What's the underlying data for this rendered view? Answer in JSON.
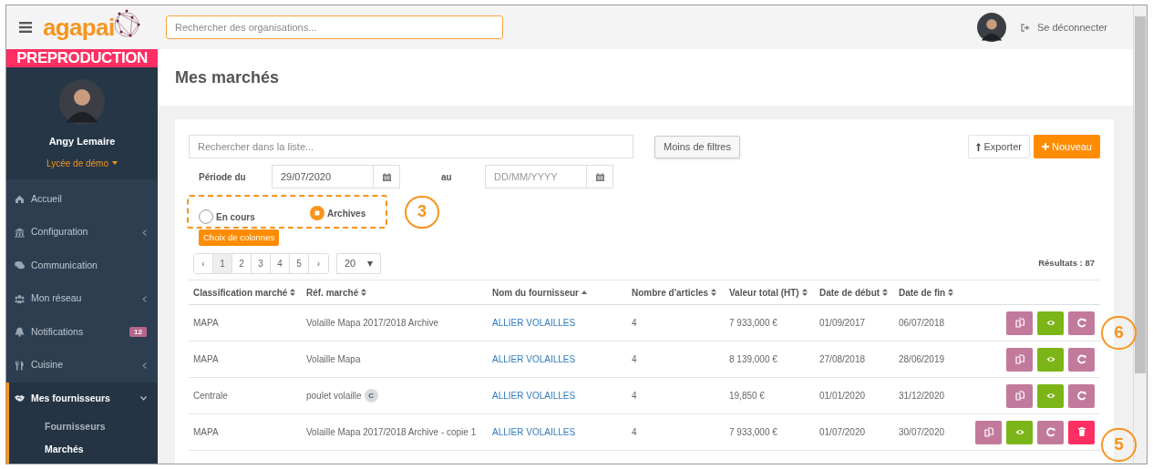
{
  "topbar": {
    "logo": "agapai",
    "search": {
      "placeholder": "Rechercher des organisations..."
    },
    "logout": "Se déconnecter"
  },
  "sidebar": {
    "banner": "PREPRODUCTION",
    "user": {
      "name": "Angy Lemaire",
      "organisation": "Lycée de démo"
    },
    "items": [
      {
        "label": "Accueil",
        "selected": false
      },
      {
        "label": "Configuration",
        "selected": false,
        "expanded": false
      },
      {
        "label": "Communication",
        "selected": false
      },
      {
        "label": "Mon réseau",
        "selected": false,
        "expanded": false
      },
      {
        "label": "Notifications",
        "selected": false,
        "badge": "12"
      },
      {
        "label": "Cuisine",
        "selected": false,
        "expanded": false
      },
      {
        "label": "Mes fournisseurs",
        "selected": true,
        "expanded": true,
        "children": [
          {
            "label": "Fournisseurs",
            "selected": false
          },
          {
            "label": "Marchés",
            "selected": true
          }
        ]
      }
    ]
  },
  "page": {
    "title": "Mes marchés"
  },
  "filters": {
    "search": {
      "placeholder": "Rechercher dans la liste..."
    },
    "toggle_button": "Moins de filtres",
    "export_button": "Exporter",
    "new_button": "Nouveau",
    "period_label": "Période du",
    "date_from": {
      "value": "29/07/2020"
    },
    "to_label": "au",
    "date_to": {
      "placeholder": "DD/MM/YYYY"
    },
    "status_options": [
      {
        "label": "En cours",
        "selected": false
      },
      {
        "label": "Archives",
        "selected": true
      }
    ],
    "columns_button": "Choix de colonnes"
  },
  "pagination": {
    "pages": [
      {
        "label": "‹",
        "selected": false
      },
      {
        "label": "1",
        "selected": true
      },
      {
        "label": "2",
        "selected": false
      },
      {
        "label": "3",
        "selected": false
      },
      {
        "label": "4",
        "selected": false
      },
      {
        "label": "5",
        "selected": false
      },
      {
        "label": "›",
        "selected": false
      }
    ],
    "page_size": "20",
    "results": "Résultats : 87"
  },
  "table": {
    "columns": [
      {
        "label": "Classification marché",
        "sorted_ascending": false
      },
      {
        "label": "Réf. marché",
        "sorted_ascending": false
      },
      {
        "label": "Nom du fournisseur",
        "sorted_ascending": true
      },
      {
        "label": "Nombre d'articles",
        "sorted_ascending": false
      },
      {
        "label": "Valeur total (HT)",
        "sorted_ascending": false
      },
      {
        "label": "Date de début",
        "sorted_ascending": false
      },
      {
        "label": "Date de fin",
        "sorted_ascending": false
      }
    ],
    "rows": [
      {
        "classification": "MAPA",
        "reference": "Volaille Mapa 2017/2018 Archive",
        "supplier": "ALLIER VOLAILLES",
        "articles": "4",
        "value": "7 933,000 €",
        "start": "01/09/2017",
        "end": "06/07/2018",
        "actions": [
          {
            "kind": "copy"
          },
          {
            "kind": "view"
          },
          {
            "kind": "renew"
          }
        ]
      },
      {
        "classification": "MAPA",
        "reference": "Volaille Mapa",
        "supplier": "ALLIER VOLAILLES",
        "articles": "4",
        "value": "8 139,000 €",
        "start": "27/08/2018",
        "end": "28/06/2019",
        "actions": [
          {
            "kind": "copy"
          },
          {
            "kind": "view"
          },
          {
            "kind": "renew"
          }
        ]
      },
      {
        "classification": "Centrale",
        "reference": "poulet volaille",
        "badge": "C",
        "supplier": "ALLIER VOLAILLES",
        "articles": "4",
        "value": "19,850 €",
        "start": "01/01/2020",
        "end": "31/12/2020",
        "actions": [
          {
            "kind": "copy"
          },
          {
            "kind": "view"
          },
          {
            "kind": "renew"
          }
        ]
      },
      {
        "classification": "MAPA",
        "reference": "Volaille Mapa 2017/2018 Archive - copie 1",
        "supplier": "ALLIER VOLAILLES",
        "articles": "4",
        "value": "7 933,000 €",
        "start": "01/07/2020",
        "end": "30/07/2020",
        "actions": [
          {
            "kind": "copy"
          },
          {
            "kind": "view"
          },
          {
            "kind": "renew"
          },
          {
            "kind": "delete"
          }
        ]
      }
    ]
  },
  "callouts": [
    {
      "label": "3"
    },
    {
      "label": "6"
    },
    {
      "label": "5"
    }
  ]
}
